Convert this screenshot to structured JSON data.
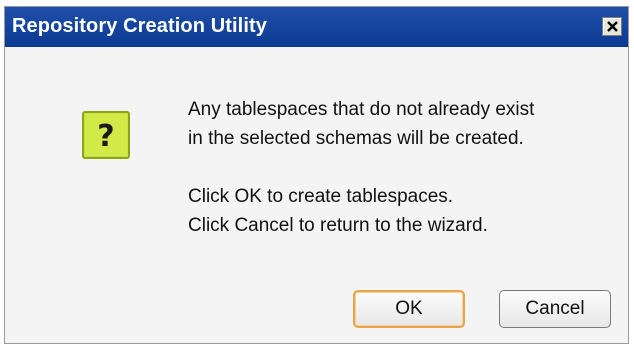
{
  "window": {
    "title": "Repository Creation Utility",
    "close_glyph": "✕"
  },
  "message": {
    "line1": "Any tablespaces that do not already exist",
    "line2": "in the selected schemas will be created.",
    "line3": "Click OK to create tablespaces.",
    "line4": "Click Cancel to return to the wizard."
  },
  "icon": {
    "name": "question-icon",
    "glyph": "?",
    "color": "#c8e23a"
  },
  "buttons": {
    "ok_label": "OK",
    "cancel_label": "Cancel"
  },
  "colors": {
    "titlebar": "#0a3a92",
    "default_button_border": "#e8a44a"
  }
}
